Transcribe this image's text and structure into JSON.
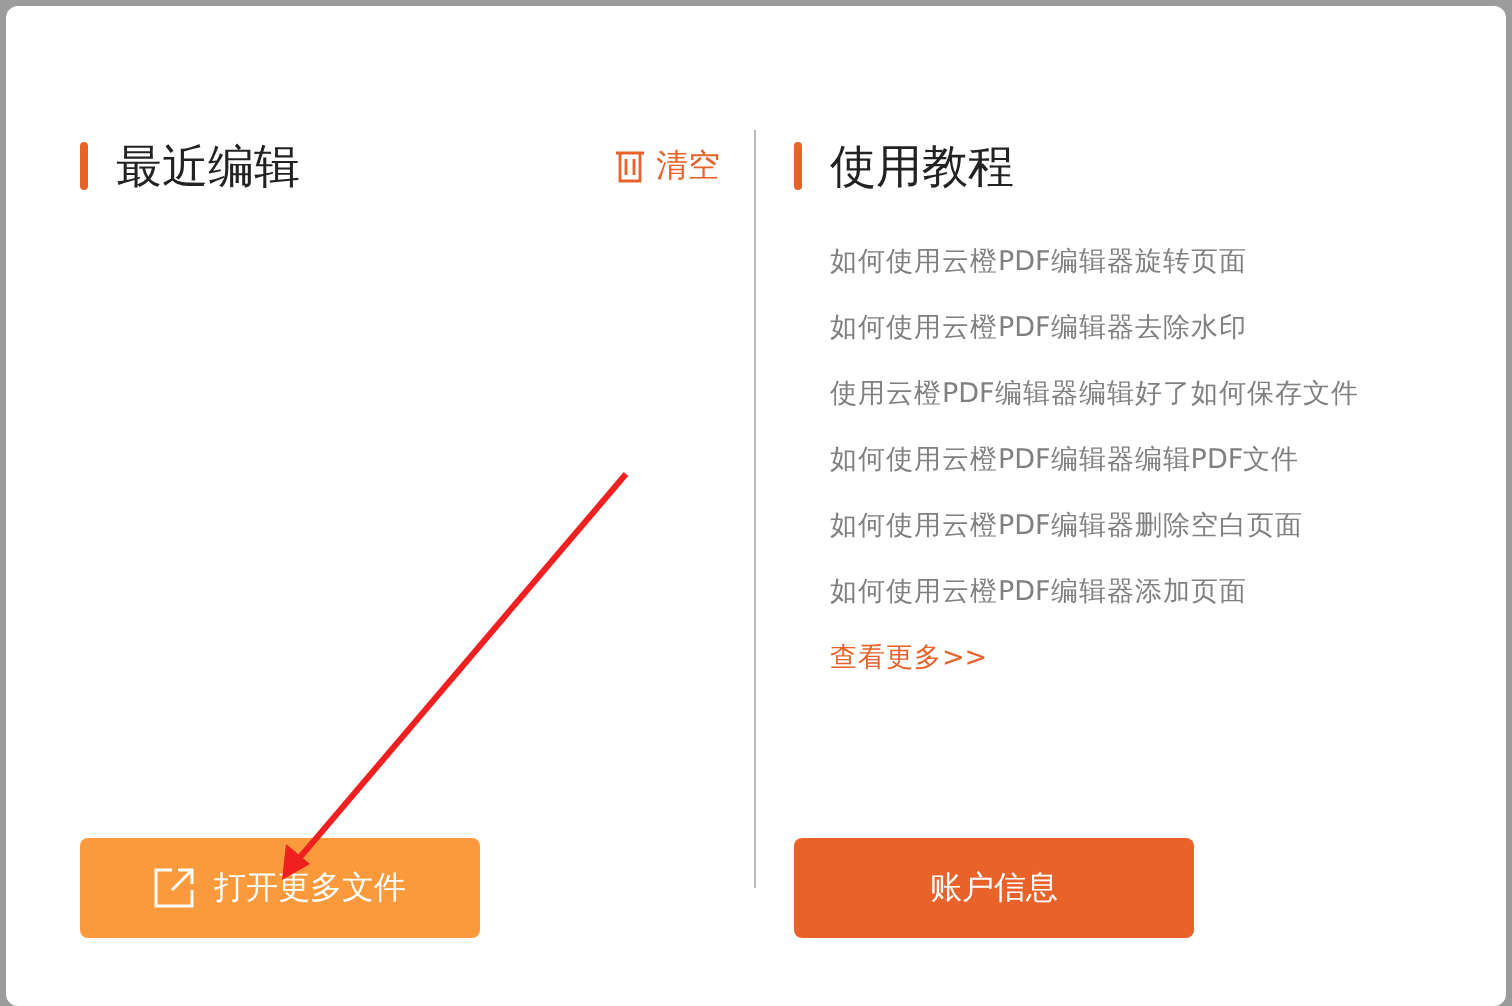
{
  "recent": {
    "title": "最近编辑",
    "clear_label": "清空",
    "open_button": "打开更多文件"
  },
  "tutorials": {
    "title": "使用教程",
    "links": [
      "如何使用云橙PDF编辑器旋转页面",
      "如何使用云橙PDF编辑器去除水印",
      "使用云橙PDF编辑器编辑好了如何保存文件",
      "如何使用云橙PDF编辑器编辑PDF文件",
      "如何使用云橙PDF编辑器删除空白页面",
      "如何使用云橙PDF编辑器添加页面"
    ],
    "more_link": "查看更多>>",
    "account_button": "账户信息"
  }
}
